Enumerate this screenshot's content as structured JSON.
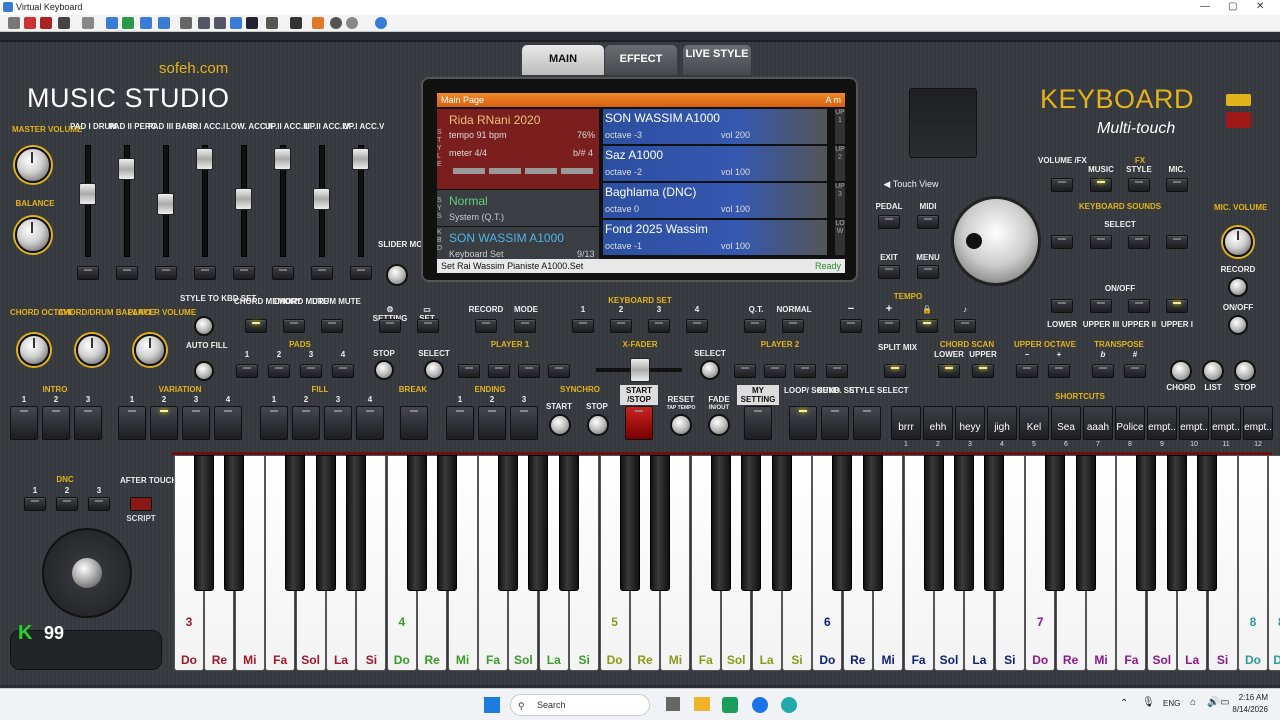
{
  "window": {
    "title": "Virtual Keyboard",
    "minimize": "—",
    "maximize": "▢",
    "close": "✕"
  },
  "brand": {
    "site": "sofeh.com",
    "name": "MUSIC STUDIO",
    "keyboard": "KEYBOARD",
    "subtitle": "Multi-touch",
    "counter": "99"
  },
  "tabs": [
    {
      "label": "MAIN"
    },
    {
      "label": "EFFECT"
    },
    {
      "label": "LIVE STYLE"
    }
  ],
  "screen": {
    "header": "Main Page",
    "key": "A m",
    "style_name": "Rida RNani 2020",
    "style_tempo": "tempo 91 bpm",
    "style_pct": "76%",
    "style_meter": "meter 4/4",
    "style_bh": "b/# 4",
    "sys_name": "Normal",
    "sys_sub": "System (Q.T.)",
    "kbd_name": "SON WASSIM A1000",
    "kbd_sub": "Keyboard Set",
    "kbd_count": "9/13",
    "status": "Set Rai Wassim Pianiste A1000.Set",
    "ready": "Ready",
    "side_left": "STYLE",
    "side_sys": "SYS",
    "side_kbd": "KBD",
    "upper": [
      {
        "tag": "UP1",
        "name": "SON WASSIM A1000",
        "octave": "octave -3",
        "vol": "vol 200"
      },
      {
        "tag": "UP2",
        "name": "Saz A1000",
        "octave": "octave -2",
        "vol": "vol 100"
      },
      {
        "tag": "UP3",
        "name": "Baghlama (DNC)",
        "octave": "octave 0",
        "vol": "vol 100"
      },
      {
        "tag": "LOW",
        "name": "Fond 2025 Wassim",
        "octave": "octave -1",
        "vol": "vol 100"
      }
    ]
  },
  "sliders": [
    "PAD I DRUM",
    "PAD II PERC.",
    "PAD III BASS",
    "UP.I ACC.I",
    "LOW. ACC.II",
    "UP.II ACC.III",
    "UP.II ACC.IV",
    "UP.I ACC.V"
  ],
  "labels": {
    "master": "MASTER VOLUME",
    "balance": "BALANCE",
    "slider_mode": "SLIDER MODE",
    "touch_view": "Touch View",
    "pedal": "PEDAL",
    "midi": "MIDI",
    "exit": "EXIT",
    "menu": "MENU",
    "volume_fx": "VOLUME /FX",
    "fx": "FX",
    "music": "MUSIC",
    "style": "STYLE",
    "mic": "MIC.",
    "keyboard_sounds": "KEYBOARD SOUNDS",
    "select": "SELECT",
    "onoff": "ON/OFF",
    "lower": "LOWER",
    "upper3": "UPPER III",
    "upper2": "UPPER II",
    "upper1": "UPPER I",
    "mic_volume": "MIC. VOLUME",
    "record": "RECORD",
    "on_off": "ON/OFF",
    "chord_octave": "CHORD OCTAVE",
    "chord_drum": "CHORD/DRUM BALANCE",
    "player_volume": "PLAYER VOLUME",
    "style_to_kbd": "STYLE TO KBD SET",
    "auto_fill": "AUTO FILL",
    "chord_memory": "CHORD MEMORY",
    "chord_mute": "CHORD MUTE",
    "drum_mute": "DRUM MUTE",
    "setting": "SETTING",
    "set": "SET",
    "record2": "RECORD",
    "mode": "MODE",
    "keyboard_set": "KEYBOARD SET",
    "qt": "Q.T.",
    "normal": "NORMAL",
    "tempo": "TEMPO",
    "minus": "−",
    "plus": "+",
    "pads": "PADS",
    "stop": "STOP",
    "player1": "PLAYER 1",
    "xfader": "X-FADER",
    "player2": "PLAYER 2",
    "split_mix": "SPLIT MIX",
    "chord_scan": "CHORD SCAN",
    "scan_lower": "LOWER",
    "scan_upper": "UPPER",
    "upper_octave": "UPPER OCTAVE",
    "transpose": "TRANSPOSE",
    "flat": "b",
    "sharp": "#",
    "chord": "CHORD",
    "list": "LIST",
    "stop2": "STOP",
    "intro": "INTRO",
    "variation": "VARIATION",
    "fill": "FILL",
    "break": "BREAK",
    "ending": "ENDING",
    "synchro": "SYNCHRO",
    "start": "START",
    "stop3": "STOP",
    "start_stop": "START /STOP",
    "reset": "RESET",
    "tap_tempo": "TAP TEMPO",
    "fade": "FADE",
    "in_out": "IN/OUT",
    "my_setting": "MY SETTING",
    "loop": "LOOP/ SOUND",
    "keyb_set": "KEYB. SET",
    "style_select": "STYLE SELECT",
    "shortcuts": "SHORTCUTS",
    "dnc": "DNC",
    "after_touch": "AFTER TOUCH",
    "script": "SCRIPT"
  },
  "shortcuts": [
    "brrr",
    "ehh",
    "heyy",
    "jigh",
    "Kel",
    "Sea",
    "aaah",
    "Police",
    "empt..",
    "empt..",
    "empt..",
    "empt.."
  ],
  "notes": [
    "Do",
    "Re",
    "Mi",
    "Fa",
    "Sol",
    "La",
    "Si"
  ],
  "octaves": [
    "3",
    "4",
    "5",
    "6",
    "7",
    "8"
  ],
  "taskbar": {
    "search": "Search",
    "lang": "ENG",
    "time": "2:16 AM",
    "date": "8/14/2026"
  }
}
